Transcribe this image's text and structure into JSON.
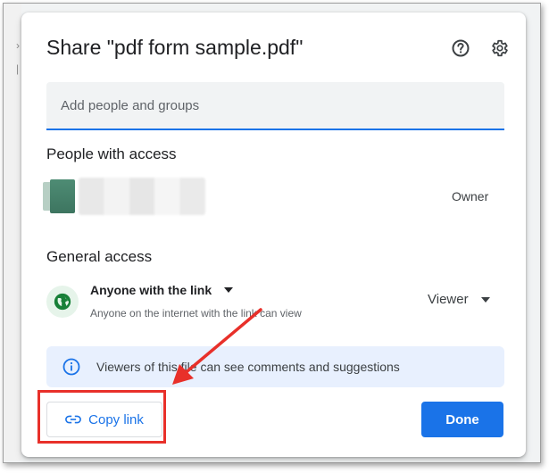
{
  "dialog": {
    "title": "Share \"pdf form sample.pdf\"",
    "help_icon": "help-circle-icon",
    "settings_icon": "gear-icon"
  },
  "add_people": {
    "placeholder": "Add people and groups"
  },
  "people_access": {
    "heading": "People with access",
    "owner_role": "Owner"
  },
  "general_access": {
    "heading": "General access",
    "link_scope": "Anyone with the link",
    "description": "Anyone on the internet with the link can view",
    "role": "Viewer"
  },
  "info": {
    "text": "Viewers of this file can see comments and suggestions"
  },
  "buttons": {
    "copy_link": "Copy link",
    "done": "Done"
  },
  "colors": {
    "accent": "#1a73e8",
    "annotation": "#e8302a",
    "globe": "#188038"
  }
}
